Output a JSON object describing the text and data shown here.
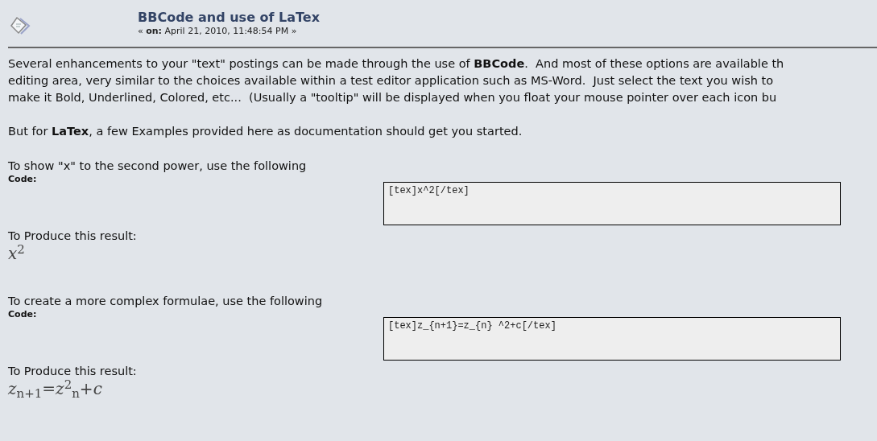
{
  "post": {
    "title": "BBCode and use of LaTex",
    "meta": "« **on:** April 21, 2010, 11:48:54 PM »"
  },
  "intro_lines": [
    "Several enhancements to your \"text\" postings can be made through the use of **BBCode**.  And most of these options are available th",
    "editing area, very similar to the choices available within a test editor application such as MS-Word.  Just select the text you wish to",
    "make it Bold, Underlined, Colored, etc...  (Usually a \"tooltip\" will be displayed when you float your mouse pointer over each icon bu"
  ],
  "latex_note": "But for **LaTex**, a few Examples provided here as documentation should get you started.",
  "examples": [
    {
      "intro": "To show \"x\" to the second power, use the following",
      "code_label": "Code:",
      "code": "[tex]x^2[/tex]",
      "result_label": "To Produce this result:",
      "result": "*x*$^{2}$"
    },
    {
      "intro": "To create a more complex formulae, use the following",
      "code_label": "Code:",
      "code": "[tex]z_{n+1}=z_{n} ^2+c[/tex]",
      "result_label": "To Produce this result:",
      "result": "*z*$_{n+1}$=*z*$^{2}$$_{n}$+*c*"
    }
  ]
}
